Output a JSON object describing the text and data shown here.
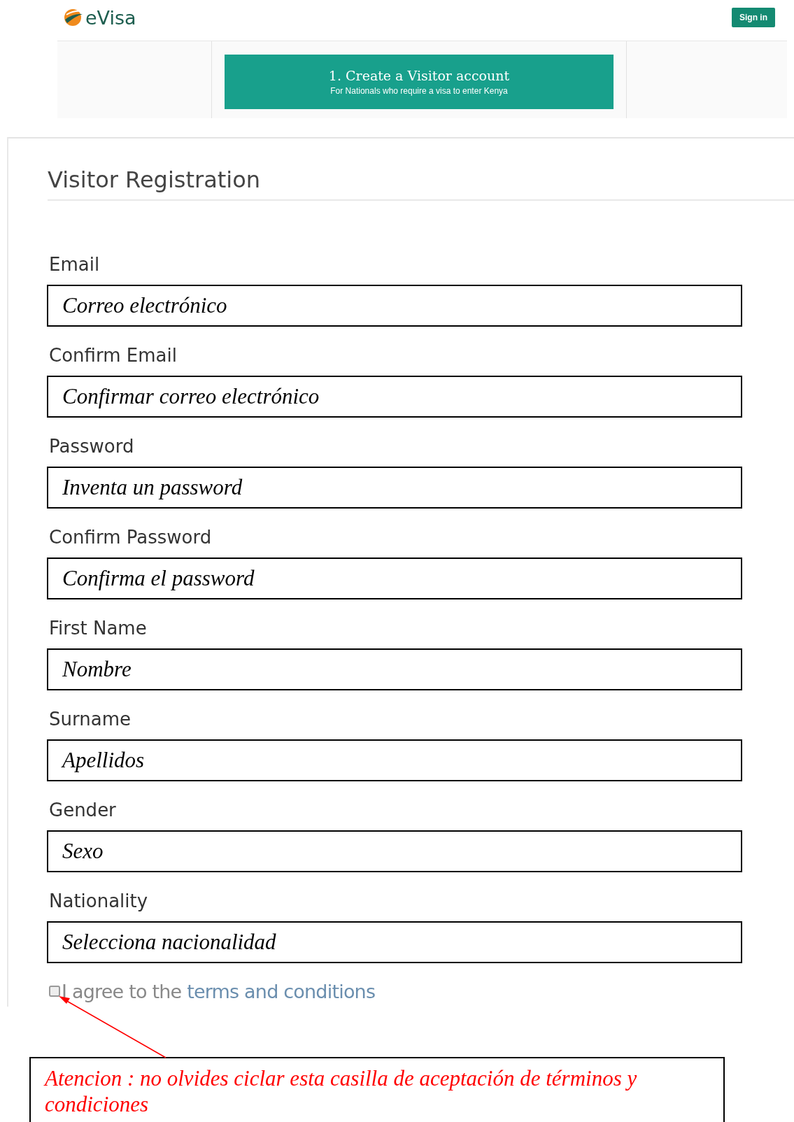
{
  "header": {
    "logo_text": "eVisa",
    "sign_in": "Sign in"
  },
  "step": {
    "title": "1. Create a Visitor account",
    "subtitle": "For Nationals who require a visa to enter Kenya"
  },
  "form": {
    "title": "Visitor Registration",
    "fields": [
      {
        "label": "Email",
        "value": "Correo electrónico"
      },
      {
        "label": "Confirm Email",
        "value": "Confirmar correo electrónico"
      },
      {
        "label": "Password",
        "value": "Inventa un password"
      },
      {
        "label": "Confirm Password",
        "value": "Confirma el password"
      },
      {
        "label": "First Name",
        "value": "Nombre"
      },
      {
        "label": "Surname",
        "value": "Apellidos"
      },
      {
        "label": "Gender",
        "value": "Sexo"
      },
      {
        "label": "Nationality",
        "value": "Selecciona nacionalidad"
      }
    ],
    "agree": {
      "checked": false,
      "text": "I agree to the",
      "link": "terms and conditions"
    }
  },
  "annotation": {
    "text": "Atencion : no olvides ciclar esta casilla de aceptación de términos y condiciones"
  }
}
